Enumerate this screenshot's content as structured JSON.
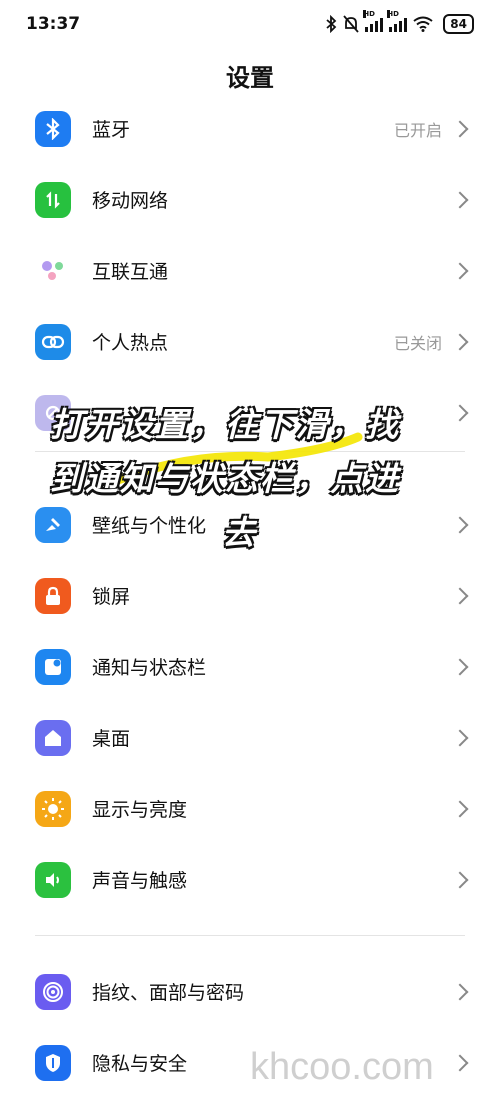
{
  "status": {
    "time": "13:37",
    "battery": "84",
    "hd1": "HD",
    "hd2": "HD"
  },
  "page_title": "设置",
  "items": [
    {
      "label": "蓝牙",
      "value": "已开启",
      "icon": "bluetooth-icon",
      "color": "#1e7cf2"
    },
    {
      "label": "移动网络",
      "value": "",
      "icon": "mobile-network-icon",
      "color": "#27c13f"
    },
    {
      "label": "互联互通",
      "value": "",
      "icon": "interconnect-icon",
      "color": ""
    },
    {
      "label": "个人热点",
      "value": "已关闭",
      "icon": "hotspot-icon",
      "color": "#1e8be8"
    },
    {
      "label": "",
      "value": "",
      "icon": "vpn-icon",
      "color": "#8a7fe0"
    },
    {
      "label": "壁纸与个性化",
      "value": "",
      "icon": "wallpaper-icon",
      "color": "#2a8ff0"
    },
    {
      "label": "锁屏",
      "value": "",
      "icon": "lock-icon",
      "color": "#f05a1e"
    },
    {
      "label": "通知与状态栏",
      "value": "",
      "icon": "notification-icon",
      "color": "#1e86f0"
    },
    {
      "label": "桌面",
      "value": "",
      "icon": "home-icon",
      "color": "#6a6ef0"
    },
    {
      "label": "显示与亮度",
      "value": "",
      "icon": "brightness-icon",
      "color": "#f5a716"
    },
    {
      "label": "声音与触感",
      "value": "",
      "icon": "sound-icon",
      "color": "#2bc13f"
    },
    {
      "label": "指纹、面部与密码",
      "value": "",
      "icon": "fingerprint-icon",
      "color": "#6a5cf0"
    },
    {
      "label": "隐私与安全",
      "value": "",
      "icon": "privacy-icon",
      "color": "#1e6ff0"
    }
  ],
  "overlay_text": {
    "line1": "打开设置，往下滑，找",
    "line2": "到通知与状态栏，点进",
    "line3": "去"
  },
  "watermark": "khcoo.com"
}
